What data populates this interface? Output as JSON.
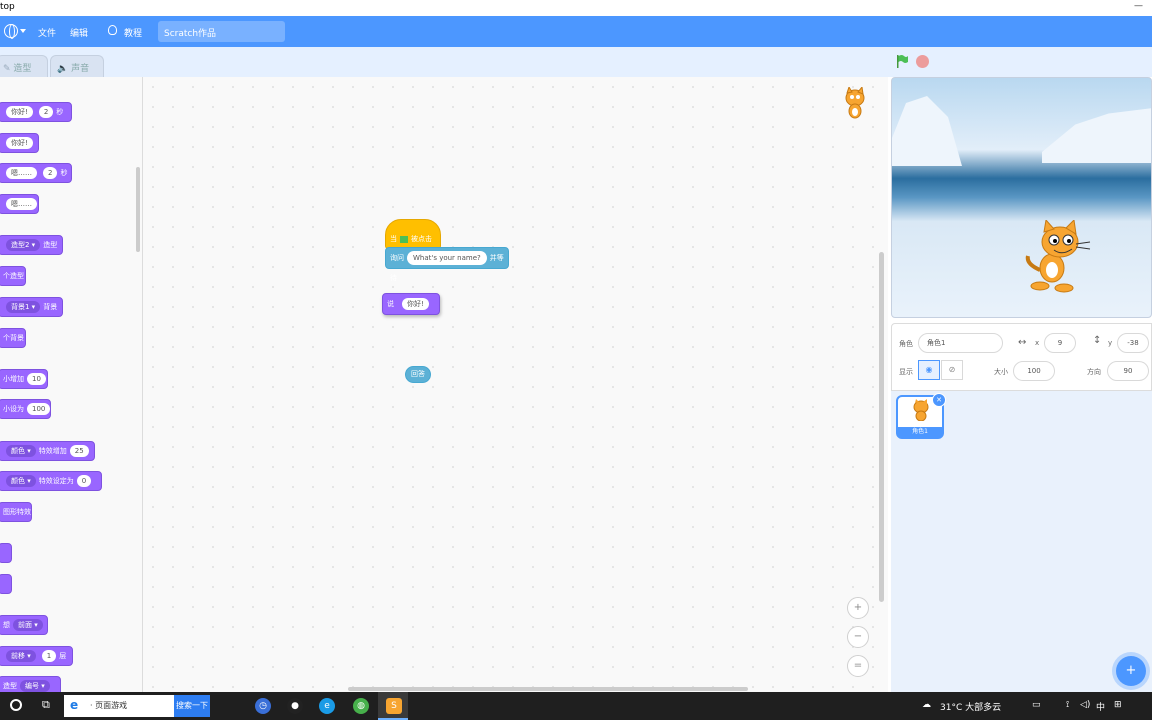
{
  "window": {
    "title_fragment": "top",
    "controls": [
      "—",
      "□"
    ]
  },
  "menubar": {
    "file": "文件",
    "edit": "编辑",
    "tutorials": "教程",
    "project_title": "Scratch作品"
  },
  "tabs": {
    "costumes": "造型",
    "sounds": "声音"
  },
  "palette": {
    "blocks": [
      {
        "parts": [
          "你好!",
          "2",
          "秒"
        ]
      },
      {
        "parts": [
          "你好!"
        ]
      },
      {
        "parts": [
          "嗯……",
          "2",
          "秒"
        ]
      },
      {
        "parts": [
          "嗯……"
        ]
      },
      {
        "parts": [
          "造型2 ▾",
          "造型"
        ]
      },
      {
        "parts": [
          "个造型"
        ]
      },
      {
        "parts": [
          "背景1 ▾",
          "背景"
        ]
      },
      {
        "parts": [
          "个背景"
        ]
      },
      {
        "parts": [
          "小增加",
          "10"
        ]
      },
      {
        "parts": [
          "小设为",
          "100"
        ]
      },
      {
        "parts": [
          "颜色 ▾",
          "特效增加",
          "25"
        ]
      },
      {
        "parts": [
          "颜色 ▾",
          "特效设定为",
          "0"
        ]
      },
      {
        "parts": [
          "图形特效"
        ]
      },
      {
        "parts": [
          ""
        ]
      },
      {
        "parts": [
          ""
        ]
      },
      {
        "parts": [
          "想",
          "前面 ▾"
        ]
      },
      {
        "parts": [
          "前移 ▾",
          "1",
          "层"
        ]
      },
      {
        "parts": [
          "造型",
          "编号 ▾"
        ]
      }
    ]
  },
  "script": {
    "hat": {
      "when": "当",
      "clicked": "被点击"
    },
    "ask": {
      "label": "询问",
      "question": "What's your name?",
      "wait": "并等待"
    },
    "say": {
      "label": "说",
      "text": "你好!"
    },
    "answer": "回答"
  },
  "zoom": {
    "in": "+",
    "out": "−",
    "reset": "="
  },
  "sprite_info": {
    "sprite_label": "角色",
    "sprite_name": "角色1",
    "x_label": "x",
    "x_value": "9",
    "y_label": "y",
    "y_value": "-38",
    "show_label": "显示",
    "size_label": "大小",
    "size_value": "100",
    "direction_label": "方向",
    "direction_value": "90"
  },
  "sprite_list": {
    "sprite_name": "角色1"
  },
  "taskbar": {
    "search_text": "· 页面游戏",
    "search_button": "搜索一下",
    "weather": "31°C  大部多云",
    "ime": "中"
  },
  "colors": {
    "scratch_blue": "#4c97ff",
    "looks_purple": "#9966ff",
    "events_yellow": "#ffbf00",
    "sensing_teal": "#5cb1d6"
  }
}
